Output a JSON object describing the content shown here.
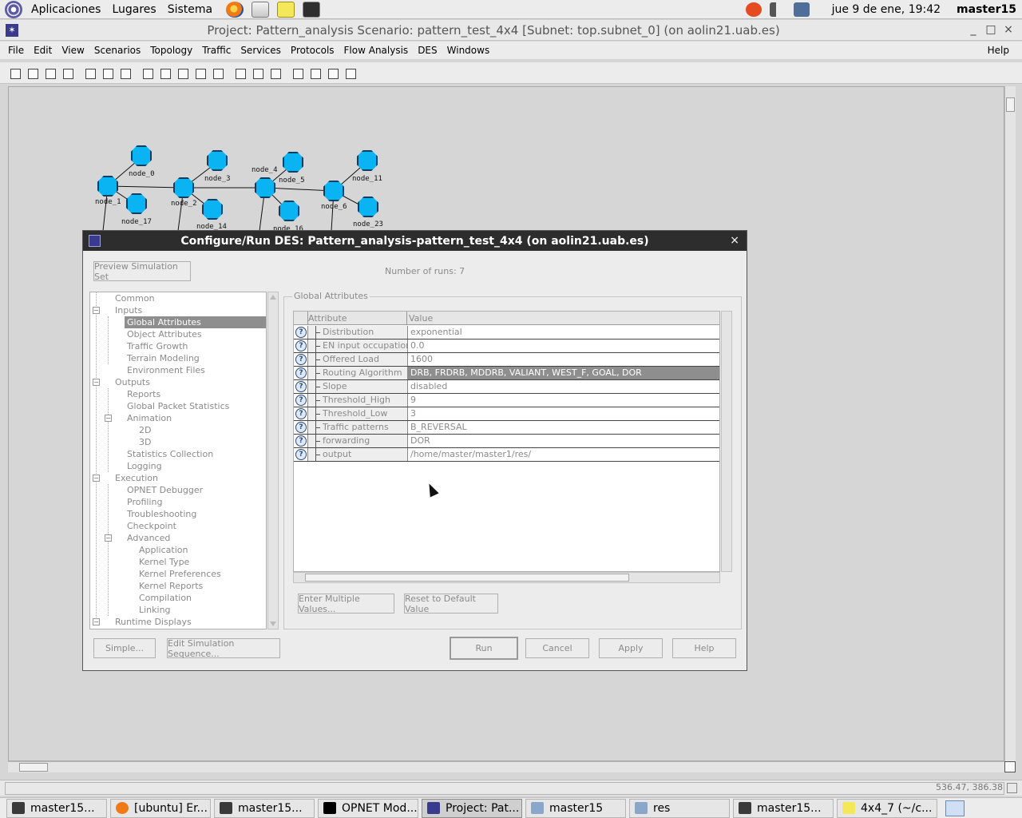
{
  "top_panel": {
    "menus": [
      "Aplicaciones",
      "Lugares",
      "Sistema"
    ],
    "clock": "jue  9 de ene, 19:42",
    "user": "master15"
  },
  "window": {
    "title": "Project: Pattern_analysis Scenario: pattern_test_4x4  [Subnet: top.subnet_0] (on aolin21.uab.es)",
    "controls": [
      "_",
      "□",
      "×"
    ]
  },
  "menubar": {
    "items": [
      "File",
      "Edit",
      "View",
      "Scenarios",
      "Topology",
      "Traffic",
      "Services",
      "Protocols",
      "Flow Analysis",
      "DES",
      "Windows"
    ],
    "help": "Help"
  },
  "canvas": {
    "nodes": [
      "node_0",
      "node_1",
      "node_2",
      "node_3",
      "node_4",
      "node_5",
      "node_6",
      "node_11",
      "node_14",
      "node_16",
      "node_17",
      "node_23"
    ]
  },
  "statusbar": {
    "coords": "536.47, 386.38"
  },
  "taskbar": {
    "tasks": [
      "master15...",
      "[ubuntu] Er...",
      "master15...",
      "OPNET Mod...",
      "Project: Pat...",
      "master15",
      "res",
      "master15...",
      "4x4_7 (~/c..."
    ]
  },
  "dialog": {
    "title": "Configure/Run DES: Pattern_analysis-pattern_test_4x4 (on aolin21.uab.es)",
    "close": "×",
    "preview_button": "Preview Simulation Set",
    "runs_label": "Number of runs: 7",
    "tree": [
      {
        "label": "Common"
      },
      {
        "label": "Inputs"
      },
      {
        "label": "Global Attributes",
        "selected": true
      },
      {
        "label": "Object Attributes"
      },
      {
        "label": "Traffic Growth"
      },
      {
        "label": "Terrain Modeling"
      },
      {
        "label": "Environment Files"
      },
      {
        "label": "Outputs"
      },
      {
        "label": "Reports"
      },
      {
        "label": "Global Packet Statistics"
      },
      {
        "label": "Animation"
      },
      {
        "label": "2D"
      },
      {
        "label": "3D"
      },
      {
        "label": "Statistics Collection"
      },
      {
        "label": "Logging"
      },
      {
        "label": "Execution"
      },
      {
        "label": "OPNET Debugger"
      },
      {
        "label": "Profiling"
      },
      {
        "label": "Troubleshooting"
      },
      {
        "label": "Checkpoint"
      },
      {
        "label": "Advanced"
      },
      {
        "label": "Application"
      },
      {
        "label": "Kernel Type"
      },
      {
        "label": "Kernel Preferences"
      },
      {
        "label": "Kernel Reports"
      },
      {
        "label": "Compilation"
      },
      {
        "label": "Linking"
      },
      {
        "label": "Runtime Displays"
      }
    ],
    "group_title": "Global Attributes",
    "columns": [
      "Attribute",
      "Value"
    ],
    "rows": [
      {
        "attribute": "Distribution",
        "value": "exponential"
      },
      {
        "attribute": "EN input occupation",
        "value": "0.0"
      },
      {
        "attribute": "Offered Load",
        "value": "1600"
      },
      {
        "attribute": "Routing Algorithm",
        "value": "DRB, FRDRB, MDDRB, VALIANT, WEST_F, GOAL, DOR"
      },
      {
        "attribute": "Slope",
        "value": "disabled"
      },
      {
        "attribute": "Threshold_High",
        "value": "9"
      },
      {
        "attribute": "Threshold_Low",
        "value": "3"
      },
      {
        "attribute": "Traffic patterns",
        "value": "B_REVERSAL"
      },
      {
        "attribute": "forwarding",
        "value": "DOR"
      },
      {
        "attribute": "output",
        "value": "/home/master/master1/res/"
      }
    ],
    "row_help_icon": "?",
    "enter_multiple_button": "Enter Multiple Values...",
    "reset_default_button": "Reset to Default Value",
    "simple_button": "Simple...",
    "edit_sequence_button": "Edit Simulation Sequence...",
    "run_button": "Run",
    "cancel_button": "Cancel",
    "apply_button": "Apply",
    "help_button": "Help"
  }
}
